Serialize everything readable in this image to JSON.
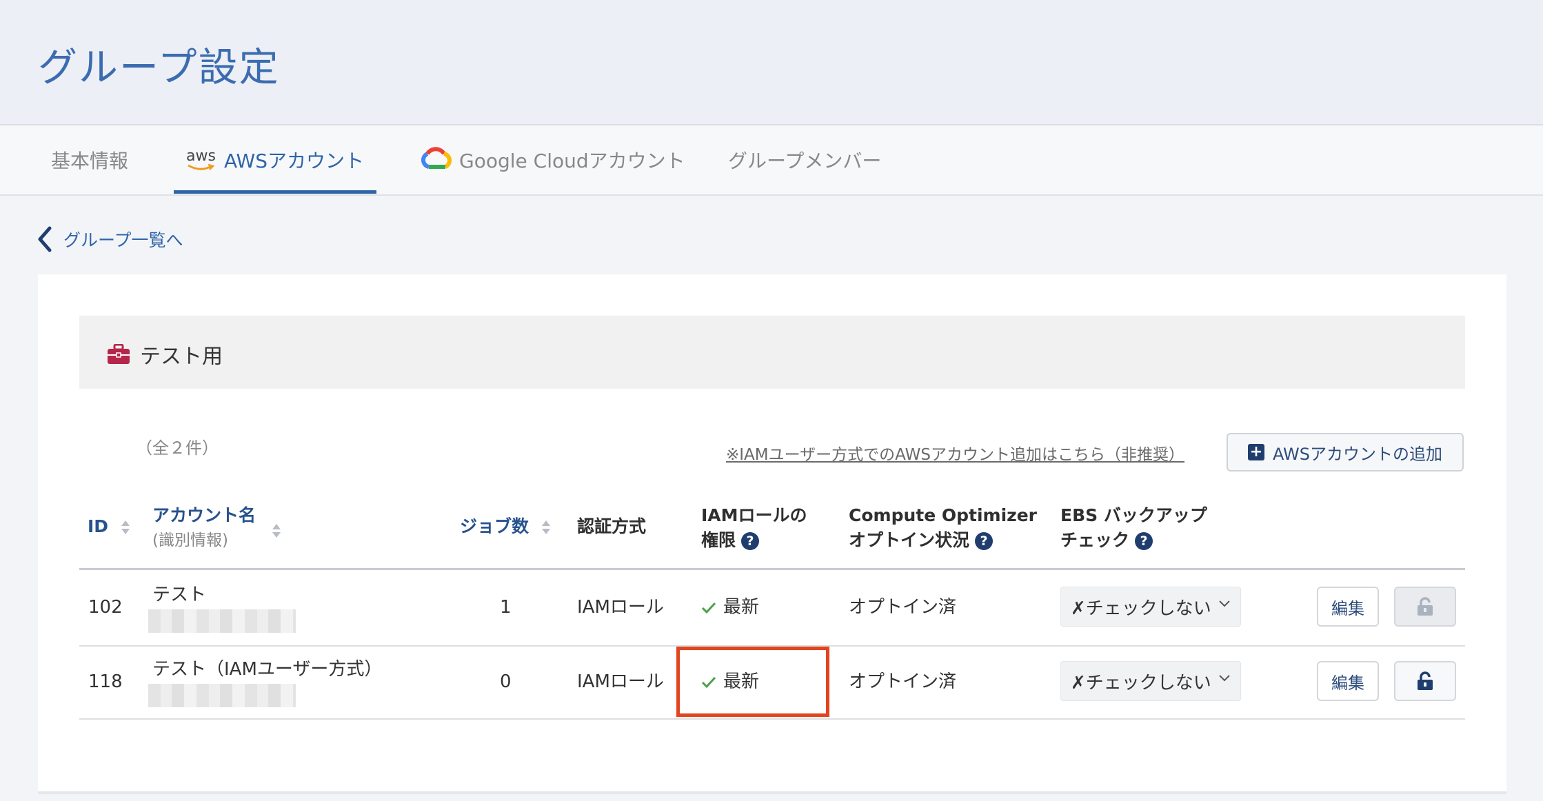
{
  "header": {
    "title": "グループ設定"
  },
  "tabs": [
    {
      "label": "基本情報",
      "icon": ""
    },
    {
      "label": "AWSアカウント",
      "icon": "aws-logo",
      "icon_text": "aws"
    },
    {
      "label": "Google Cloudアカウント",
      "icon": "google-cloud-icon"
    },
    {
      "label": "グループメンバー",
      "icon": ""
    }
  ],
  "back_link": {
    "label": "グループ一覧へ"
  },
  "group": {
    "title": "テスト用",
    "icon": "briefcase-icon",
    "icon_color": "#b5264a"
  },
  "count_text": "（全２件）",
  "iam_link": "※IAMユーザー方式でのAWSアカウント追加はこちら（非推奨）",
  "add_button": {
    "label": "AWSアカウントの追加"
  },
  "table": {
    "headers": {
      "id": "ID",
      "account_name": "アカウント名",
      "account_name_sub": "(識別情報)",
      "jobs": "ジョブ数",
      "auth": "認証方式",
      "iam_line1": "IAMロールの",
      "iam_line2": "権限",
      "co_line1": "Compute Optimizer",
      "co_line2": "オプトイン状況",
      "ebs_line1": "EBS バックアップ",
      "ebs_line2": "チェック"
    },
    "rows": [
      {
        "id": "102",
        "name": "テスト",
        "jobs": "1",
        "auth": "IAMロール",
        "iam": "最新",
        "co": "オプトイン済",
        "ebs": "✗チェックしない",
        "edit": "編集",
        "lock": "disabled"
      },
      {
        "id": "118",
        "name": "テスト（IAMユーザー方式）",
        "jobs": "0",
        "auth": "IAMロール",
        "iam": "最新",
        "co": "オプトイン済",
        "ebs": "✗チェックしない",
        "edit": "編集",
        "lock": "enabled"
      }
    ]
  },
  "colors": {
    "accent": "#2f64a8",
    "highlight": "#e0451f",
    "check": "#4aa14a",
    "navy": "#1f3e6e"
  }
}
